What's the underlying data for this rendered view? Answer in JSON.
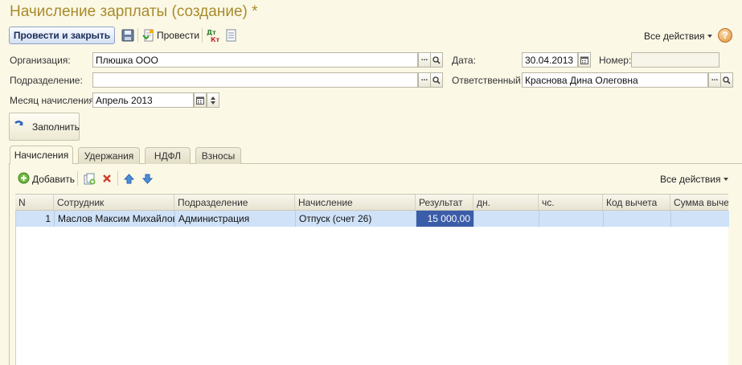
{
  "window": {
    "title": "Начисление зарплаты (создание) *"
  },
  "toolbar": {
    "post_and_close": "Провести и закрыть",
    "post": "Провести",
    "all_actions": "Все действия"
  },
  "form": {
    "organization_label": "Организация:",
    "organization_value": "Плюшка ООО",
    "date_label": "Дата:",
    "date_value": "30.04.2013",
    "number_label": "Номер:",
    "number_value": "",
    "department_label": "Подразделение:",
    "department_value": "",
    "responsible_label": "Ответственный:",
    "responsible_value": "Краснова Дина Олеговна",
    "month_label": "Месяц начисления:",
    "month_value": "Апрель 2013",
    "fill_button": "Заполнить"
  },
  "tabs": [
    {
      "label": "Начисления",
      "active": true
    },
    {
      "label": "Удержания",
      "active": false
    },
    {
      "label": "НДФЛ",
      "active": false
    },
    {
      "label": "Взносы",
      "active": false
    }
  ],
  "table_toolbar": {
    "add": "Добавить",
    "all_actions": "Все действия"
  },
  "table": {
    "columns": [
      "N",
      "Сотрудник",
      "Подразделение",
      "Начисление",
      "Результат",
      "дн.",
      "чс.",
      "Код вычета",
      "Сумма вычет"
    ],
    "rows": [
      [
        "1",
        "Маслов Максим Михайлович",
        "Администрация",
        "Отпуск (счет 26)",
        "15 000,00",
        "",
        "",
        "",
        ""
      ]
    ]
  },
  "colors": {
    "title": "#a88b2b",
    "background": "#fbf8e6",
    "selected_row": "#cfe2f7",
    "selected_cell": "#3b5ca8"
  }
}
